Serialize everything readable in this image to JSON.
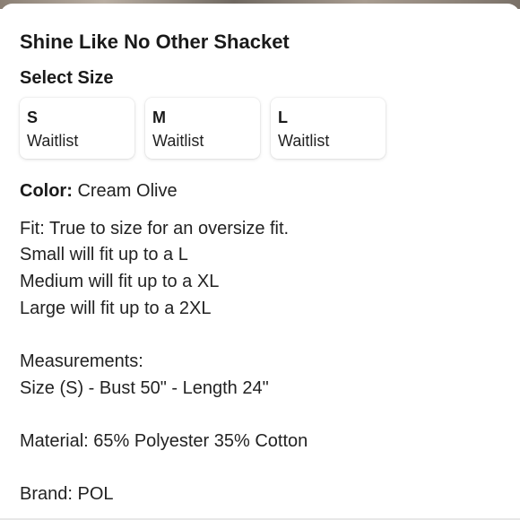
{
  "product": {
    "title": "Shine Like No Other Shacket"
  },
  "size_selector": {
    "heading": "Select Size",
    "options": [
      {
        "size": "S",
        "status": "Waitlist"
      },
      {
        "size": "M",
        "status": "Waitlist"
      },
      {
        "size": "L",
        "status": "Waitlist"
      }
    ]
  },
  "color": {
    "label": "Color:",
    "value": "Cream Olive"
  },
  "description": {
    "lines": [
      "Fit: True to size for an oversize fit.",
      "Small will fit up to a L",
      "Medium will fit up to a XL",
      "Large will fit up to a 2XL",
      "",
      "Measurements:",
      "Size (S) - Bust 50\" - Length 24\"",
      "",
      "Material: 65% Polyester 35% Cotton",
      "",
      "Brand: POL"
    ]
  }
}
